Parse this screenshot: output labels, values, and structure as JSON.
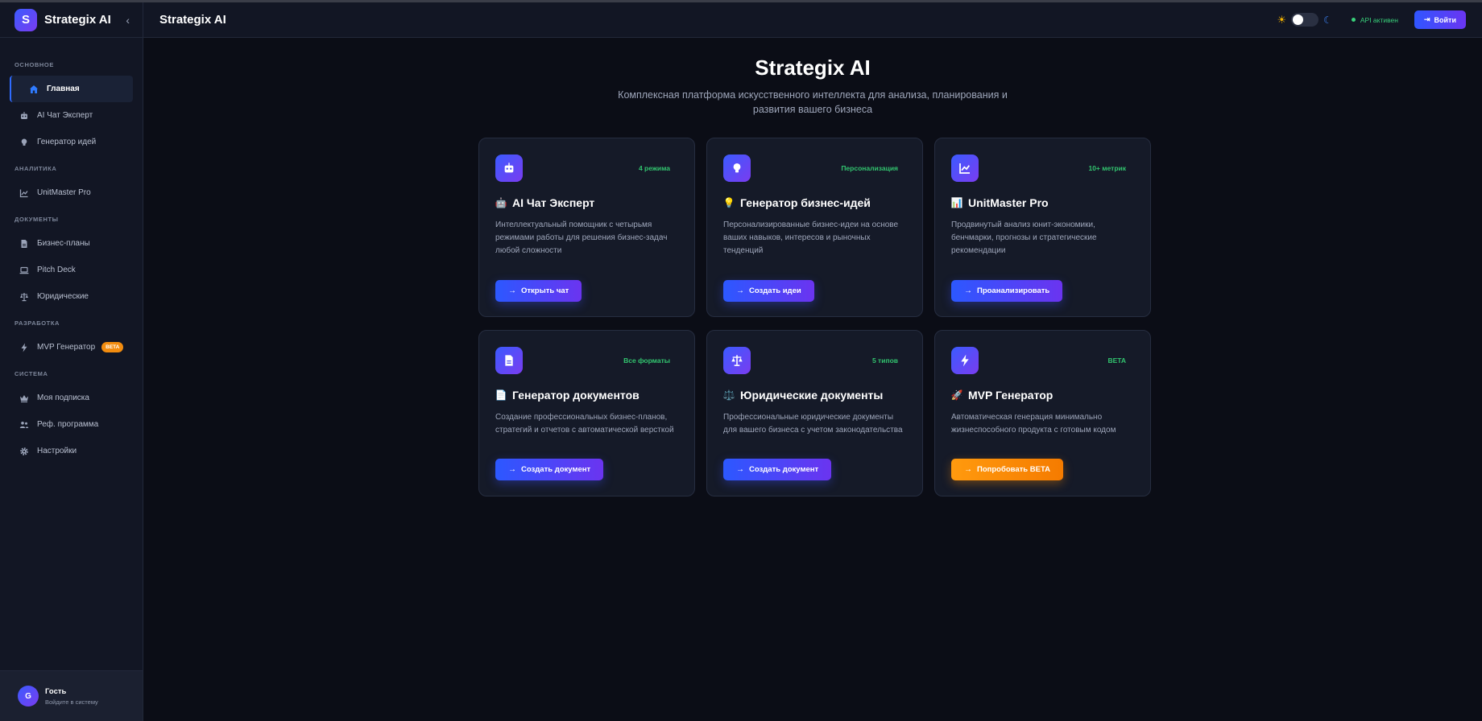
{
  "sidebar": {
    "logo_letter": "S",
    "brand": "Strategix AI",
    "collapse_icon": "chevron-left-icon",
    "sections": [
      {
        "title": "ОСНОВНОЕ",
        "items": [
          {
            "label": "Главная",
            "icon": "home-icon",
            "active": true
          },
          {
            "label": "AI Чат Эксперт",
            "icon": "robot-icon"
          },
          {
            "label": "Генератор идей",
            "icon": "lightbulb-icon"
          }
        ]
      },
      {
        "title": "АНАЛИТИКА",
        "items": [
          {
            "label": "UnitMaster Pro",
            "icon": "chart-line-icon"
          }
        ]
      },
      {
        "title": "ДОКУМЕНТЫ",
        "items": [
          {
            "label": "Бизнес-планы",
            "icon": "file-icon"
          },
          {
            "label": "Pitch Deck",
            "icon": "laptop-icon"
          },
          {
            "label": "Юридические",
            "icon": "scale-icon"
          }
        ]
      },
      {
        "title": "РАЗРАБОТКА",
        "items": [
          {
            "label": "MVP Генератор",
            "icon": "bolt-icon",
            "badge": "BETA"
          }
        ]
      },
      {
        "title": "СИСТЕМА",
        "items": [
          {
            "label": "Моя подписка",
            "icon": "crown-icon"
          },
          {
            "label": "Реф. программа",
            "icon": "users-icon"
          },
          {
            "label": "Настройки",
            "icon": "gear-icon"
          }
        ]
      }
    ],
    "user": {
      "initial": "G",
      "name": "Гость",
      "subtitle": "Войдите в систему"
    }
  },
  "topbar": {
    "title": "Strategix AI",
    "api_status": "API активен",
    "login_label": "Войти"
  },
  "hero": {
    "title": "Strategix AI",
    "subtitle": "Комплексная платформа искусственного интеллекта для анализа, планирования и развития вашего бизнеса"
  },
  "cards": [
    {
      "icon": "robot-icon",
      "badge": "4 режима",
      "emoji": "🤖",
      "title": "AI Чат Эксперт",
      "description": "Интеллектуальный помощник с четырьмя режимами работы для решения бизнес-задач любой сложности",
      "button": "Открыть чат"
    },
    {
      "icon": "lightbulb-icon",
      "badge": "Персонализация",
      "emoji": "💡",
      "title": "Генератор бизнес-идей",
      "description": "Персонализированные бизнес-идеи на основе ваших навыков, интересов и рыночных тенденций",
      "button": "Создать идеи"
    },
    {
      "icon": "chart-line-icon",
      "badge": "10+ метрик",
      "emoji": "📊",
      "title": "UnitMaster Pro",
      "description": "Продвинутый анализ юнит-экономики, бенчмарки, прогнозы и стратегические рекомендации",
      "button": "Проанализировать"
    },
    {
      "icon": "file-icon",
      "badge": "Все форматы",
      "emoji": "📄",
      "title": "Генератор документов",
      "description": "Создание профессиональных бизнес-планов, стратегий и отчетов с автоматической версткой",
      "button": "Создать документ"
    },
    {
      "icon": "scale-icon",
      "badge": "5 типов",
      "emoji": "⚖️",
      "title": "Юридические документы",
      "description": "Профессиональные юридические документы для вашего бизнеса с учетом законодательства",
      "button": "Создать документ"
    },
    {
      "icon": "bolt-icon",
      "badge": "BETA",
      "emoji": "🚀",
      "title": "MVP Генератор",
      "description": "Автоматическая генерация минимально жизнеспособного продукта с готовым кодом",
      "button": "Попробовать BETA"
    }
  ],
  "colors": {
    "accent": "#2f6bff",
    "brand_gradient_end": "#7a3cf0",
    "status_green": "#39d07a",
    "beta_orange": "#f28c0f"
  }
}
